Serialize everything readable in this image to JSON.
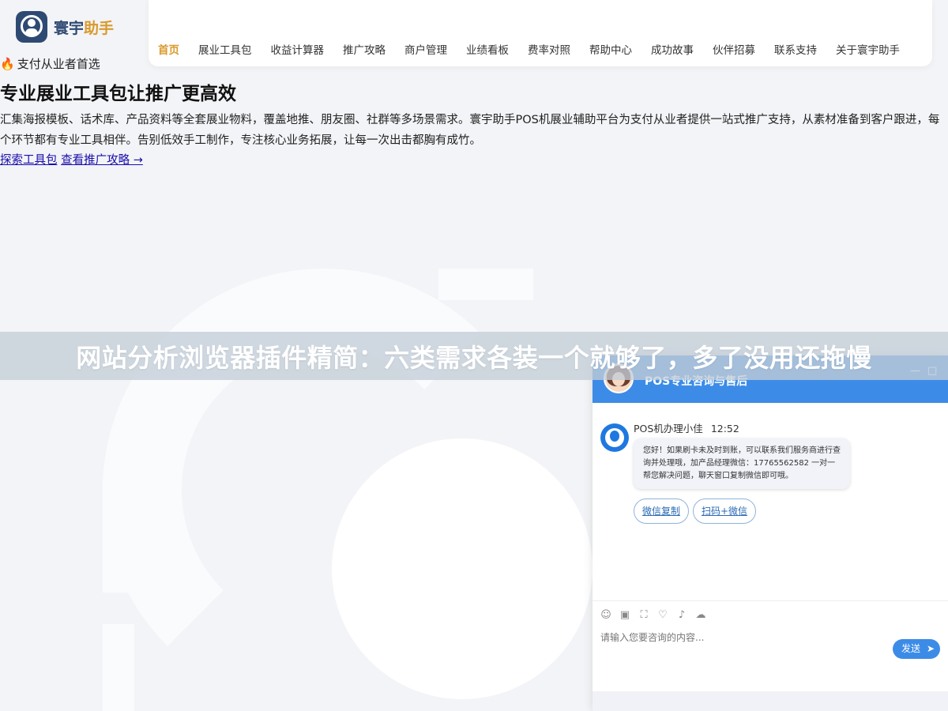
{
  "brand": {
    "name_main": "寰宇",
    "name_accent": "助手"
  },
  "nav": {
    "items": [
      "首页",
      "展业工具包",
      "收益计算器",
      "推广攻略",
      "商户管理",
      "业绩看板",
      "费率对照",
      "帮助中心",
      "成功故事",
      "伙伴招募",
      "联系支持",
      "关于寰宇助手"
    ],
    "active_index": 0
  },
  "hero": {
    "tag": "支付从业者首选",
    "title": "专业展业工具包让推广更高效",
    "description": "汇集海报模板、话术库、产品资料等全套展业物料，覆盖地推、朋友圈、社群等多场景需求。寰宇助手POS机展业辅助平台为支付从业者提供一站式推广支持，从素材准备到客户跟进，每个环节都有专业工具相伴。告别低效手工制作，专注核心业务拓展，让每一次出击都胸有成竹。",
    "link_tools": "探索工具包",
    "link_guide": "查看推广攻略 →"
  },
  "banner": {
    "text": "网站分析浏览器插件精简：六类需求各装一个就够了，多了没用还拖慢"
  },
  "chat": {
    "title": "POS专业咨询与售后",
    "minimize": "—",
    "maximize": "□",
    "agent_name": "POS机办理小佳",
    "time": "12:52",
    "message": "您好！如果刷卡未及时到账，可以联系我们服务商进行查询并处理哦，加产品经理微信：17765562582 一对一帮您解决问题，聊天窗口复制微信即可哦。",
    "chips": [
      "微信复制",
      "扫码+微信"
    ],
    "input_placeholder": "请输入您要咨询的内容...",
    "send_label": "发送",
    "tools": [
      "emoji-icon",
      "image-icon",
      "screenshot-icon",
      "rate-icon",
      "sound-icon",
      "wechat-icon"
    ]
  },
  "colors": {
    "accent": "#d99a2b",
    "brand": "#2e4a73",
    "chat_blue": "#3c8ce7"
  }
}
